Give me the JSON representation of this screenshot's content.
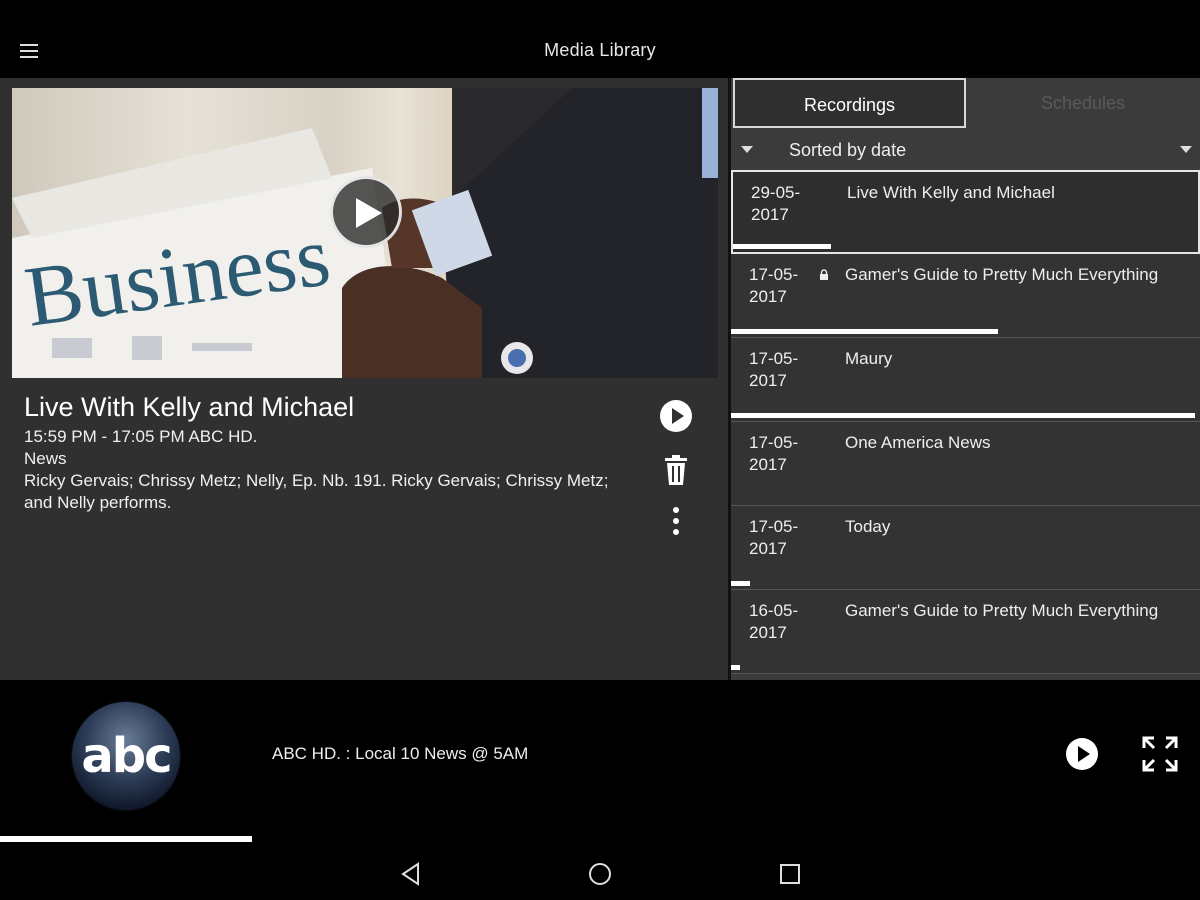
{
  "app": {
    "title": "Media Library"
  },
  "program": {
    "title": "Live With Kelly and Michael",
    "time_channel": "15:59 PM - 17:05 PM   ABC HD.",
    "genre": "News",
    "description": "Ricky Gervais; Chrissy Metz; Nelly, Ep. Nb. 191. Ricky Gervais; Chrissy Metz; and Nelly performs.",
    "hero_image_text": "Business"
  },
  "tabs": {
    "recordings": "Recordings",
    "schedules": "Schedules"
  },
  "sort": {
    "label": "Sorted by date"
  },
  "recordings": [
    {
      "date_line1": "29-05-",
      "date_line2": "2017",
      "title": "Live With Kelly and Michael",
      "locked": false,
      "progress": 0.21,
      "selected": true
    },
    {
      "date_line1": "17-05-",
      "date_line2": "2017",
      "title": "Gamer's Guide to Pretty Much Everything",
      "locked": true,
      "progress": 0.57,
      "selected": false
    },
    {
      "date_line1": "17-05-",
      "date_line2": "2017",
      "title": "Maury",
      "locked": false,
      "progress": 0.99,
      "selected": false
    },
    {
      "date_line1": "17-05-",
      "date_line2": "2017",
      "title": "One America News",
      "locked": false,
      "progress": 0.0,
      "selected": false
    },
    {
      "date_line1": "17-05-",
      "date_line2": "2017",
      "title": "Today",
      "locked": false,
      "progress": 0.04,
      "selected": false
    },
    {
      "date_line1": "16-05-",
      "date_line2": "2017",
      "title": "Gamer's Guide to Pretty Much Everything",
      "locked": false,
      "progress": 0.02,
      "selected": false
    }
  ],
  "player": {
    "logo_text": "abc",
    "now_playing": "ABC HD. : Local 10 News @ 5AM",
    "progress": 0.21
  },
  "icons": {
    "menu": "menu-icon",
    "hero_play": "play-icon",
    "play": "play-circle-icon",
    "delete": "trash-icon",
    "more": "more-vert-icon",
    "lock": "lock-icon",
    "fullscreen": "fullscreen-icon",
    "back": "back-icon",
    "home": "home-icon",
    "recents": "recents-icon"
  },
  "colors": {
    "background": "#000000",
    "panel": "#323232",
    "list_item": "#333333",
    "accent": "#ffffff"
  }
}
